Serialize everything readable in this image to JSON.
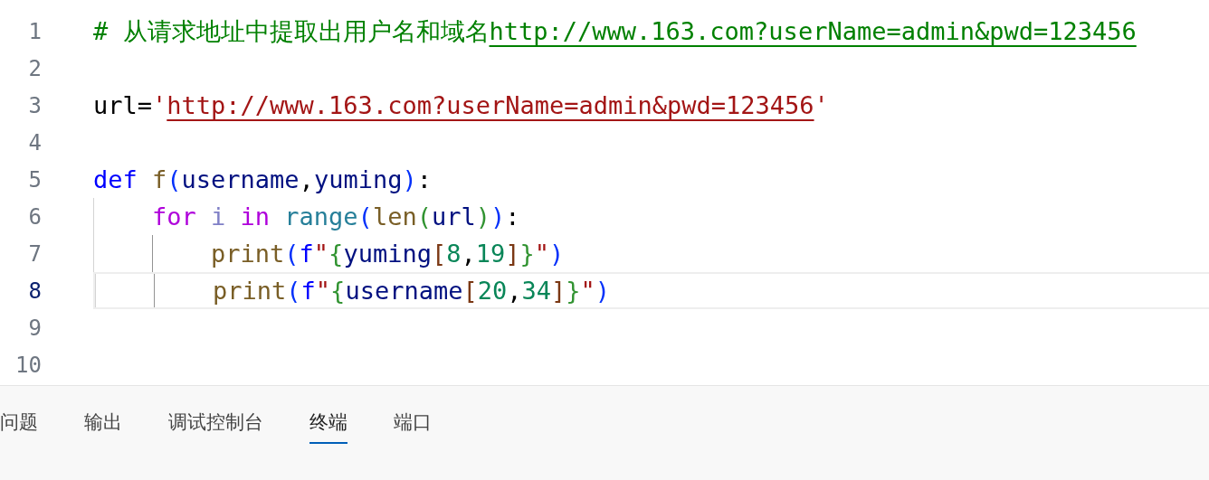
{
  "editor": {
    "lines": [
      {
        "number": "1",
        "current": false,
        "words": [
          [
            {
              "kind": "comment",
              "text": "#"
            }
          ],
          [
            {
              "kind": "comment",
              "text": "从请求地址中提取出用户名和域名"
            },
            {
              "kind": "comment-link",
              "text": "http://www.163.com?userName=admin&pwd=123456"
            }
          ]
        ]
      },
      {
        "number": "2",
        "current": false
      },
      {
        "number": "3",
        "current": false,
        "words": [
          [
            {
              "kind": "plain",
              "text": "url="
            },
            {
              "kind": "string",
              "text": "'"
            },
            {
              "kind": "string-link",
              "text": "http://www.163.com?userName=admin&pwd=123456"
            },
            {
              "kind": "string",
              "text": "'"
            }
          ]
        ]
      },
      {
        "number": "4",
        "current": false
      },
      {
        "number": "5",
        "current": false,
        "words": [
          [
            {
              "kind": "keyword",
              "text": "def"
            }
          ],
          [
            {
              "kind": "function",
              "text": "f"
            },
            {
              "kind": "bracket1",
              "text": "("
            },
            {
              "kind": "variable",
              "text": "username"
            },
            {
              "kind": "plain",
              "text": ","
            },
            {
              "kind": "variable",
              "text": "yuming"
            },
            {
              "kind": "bracket1",
              "text": ")"
            },
            {
              "kind": "plain",
              "text": ":"
            }
          ]
        ]
      },
      {
        "number": "6",
        "current": false,
        "guides": [
          {
            "active": false
          }
        ],
        "words": [
          [
            {
              "kind": "control",
              "text": "for"
            }
          ],
          [
            {
              "kind": "unused",
              "text": "i"
            }
          ],
          [
            {
              "kind": "control",
              "text": "in"
            }
          ],
          [
            {
              "kind": "builtin",
              "text": "range"
            },
            {
              "kind": "bracket1",
              "text": "("
            },
            {
              "kind": "function",
              "text": "len"
            },
            {
              "kind": "bracket2",
              "text": "("
            },
            {
              "kind": "variable",
              "text": "url"
            },
            {
              "kind": "bracket2",
              "text": ")"
            },
            {
              "kind": "bracket1",
              "text": ")"
            },
            {
              "kind": "plain",
              "text": ":"
            }
          ]
        ]
      },
      {
        "number": "7",
        "current": false,
        "guides": [
          {
            "active": false
          },
          {
            "active": true
          }
        ],
        "words": [
          [
            {
              "kind": "function",
              "text": "print"
            },
            {
              "kind": "bracket1",
              "text": "("
            },
            {
              "kind": "keyword",
              "text": "f"
            },
            {
              "kind": "string",
              "text": "\""
            },
            {
              "kind": "bracket2",
              "text": "{"
            },
            {
              "kind": "variable",
              "text": "yuming"
            },
            {
              "kind": "bracket3",
              "text": "["
            },
            {
              "kind": "number",
              "text": "8"
            },
            {
              "kind": "plain",
              "text": ","
            },
            {
              "kind": "number",
              "text": "19"
            },
            {
              "kind": "bracket3",
              "text": "]"
            },
            {
              "kind": "bracket2",
              "text": "}"
            },
            {
              "kind": "string",
              "text": "\""
            },
            {
              "kind": "bracket1",
              "text": ")"
            }
          ]
        ]
      },
      {
        "number": "8",
        "current": true,
        "guides": [
          {
            "active": false
          },
          {
            "active": true
          }
        ],
        "words": [
          [
            {
              "kind": "function",
              "text": "print"
            },
            {
              "kind": "bracket1",
              "text": "("
            },
            {
              "kind": "keyword",
              "text": "f"
            },
            {
              "kind": "string",
              "text": "\""
            },
            {
              "kind": "bracket2",
              "text": "{"
            },
            {
              "kind": "variable",
              "text": "username"
            },
            {
              "kind": "bracket3",
              "text": "["
            },
            {
              "kind": "number",
              "text": "20"
            },
            {
              "kind": "plain",
              "text": ","
            },
            {
              "kind": "number",
              "text": "34"
            },
            {
              "kind": "bracket3",
              "text": "]"
            },
            {
              "kind": "bracket2",
              "text": "}"
            },
            {
              "kind": "string",
              "text": "\""
            },
            {
              "kind": "bracket1",
              "text": ")"
            }
          ]
        ]
      },
      {
        "number": "9",
        "current": false
      },
      {
        "number": "10",
        "current": false
      }
    ]
  },
  "panel": {
    "tabs": [
      {
        "label": "问题",
        "selected": false
      },
      {
        "label": "输出",
        "selected": false
      },
      {
        "label": "调试控制台",
        "selected": false
      },
      {
        "label": "终端",
        "selected": true
      },
      {
        "label": "端口",
        "selected": false
      }
    ]
  }
}
